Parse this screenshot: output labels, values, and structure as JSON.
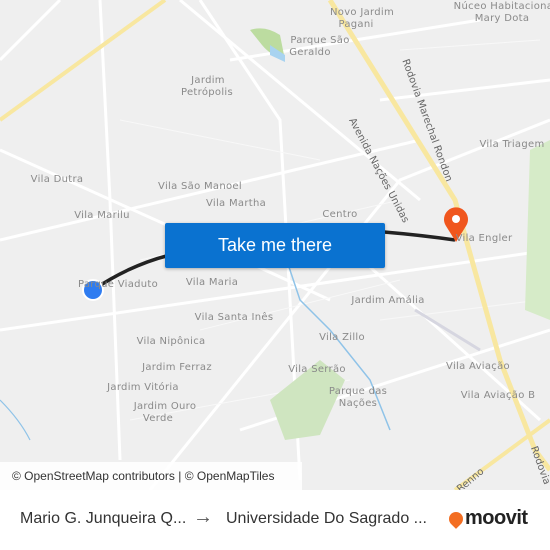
{
  "map": {
    "neighborhoods": [
      "Novo Jardim",
      "Pagani",
      "Núceo Habitacional",
      "Mary Dota",
      "Parque São",
      "Geraldo",
      "Jardim",
      "Petrópolis",
      "Vila Dutra",
      "Vila São Manoel",
      "Vila Martha",
      "Vila Marilu",
      "Centro",
      "Vila Triagem",
      "Vila Engler",
      "Parque Viaduto",
      "Vila Maria",
      "Jardim Amália",
      "Vila Santa Inês",
      "Vila Nipônica",
      "Vila Zillo",
      "Jardim Ferraz",
      "Vila Serrão",
      "Vila Aviação",
      "Jardim Vitória",
      "Parque das",
      "Nações",
      "Vila Aviação B",
      "Jardim Ouro",
      "Verde"
    ],
    "roads": [
      "Rodovia Marechal Rondon",
      "Avenida Nações Unidas",
      "Rodovia",
      "Renno"
    ],
    "origin_marker_color": "#2f7cf0",
    "destination_marker_color": "#f0561d",
    "route_color": "#222222"
  },
  "cta": {
    "label": "Take me there",
    "color": "#0a72d0"
  },
  "attribution": "© OpenStreetMap contributors | © OpenMapTiles",
  "footer": {
    "origin": "Mario G. Junqueira Q...",
    "arrow": "→",
    "destination": "Universidade Do Sagrado ...",
    "brand": "moovit",
    "brand_color": "#f36e22"
  }
}
